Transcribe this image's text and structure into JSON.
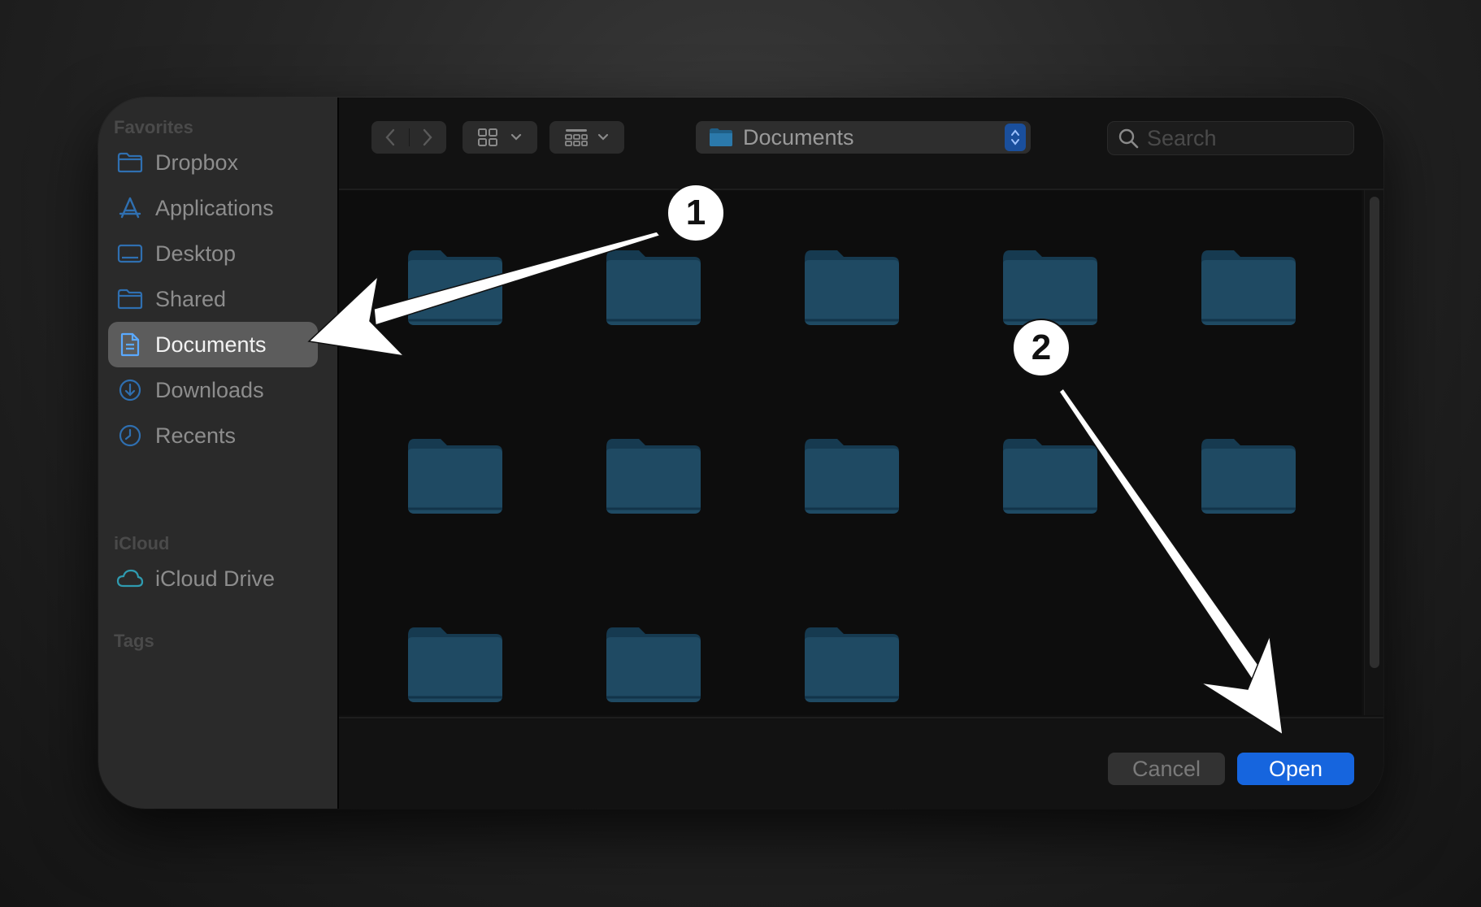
{
  "sidebar": {
    "favorites_label": "Favorites",
    "items": [
      {
        "label": "Dropbox",
        "icon": "folder-icon"
      },
      {
        "label": "Applications",
        "icon": "applications-icon"
      },
      {
        "label": "Desktop",
        "icon": "desktop-icon"
      },
      {
        "label": "Shared",
        "icon": "folder-icon"
      },
      {
        "label": "Documents",
        "icon": "document-icon",
        "selected": true
      },
      {
        "label": "Downloads",
        "icon": "download-icon"
      },
      {
        "label": "Recents",
        "icon": "clock-icon"
      }
    ],
    "icloud_label": "iCloud",
    "icloud_items": [
      {
        "label": "iCloud Drive",
        "icon": "cloud-icon"
      }
    ],
    "tags_label": "Tags"
  },
  "toolbar": {
    "path_label": "Documents",
    "search_placeholder": "Search"
  },
  "folder_count": 13,
  "buttons": {
    "cancel": "Cancel",
    "open": "Open"
  },
  "annotations": {
    "step1": "1",
    "step2": "2"
  },
  "colors": {
    "accent": "#1665de",
    "folder": "#1f4a63",
    "sidebar_icon": "#2f6fb0",
    "selection": "#5c5c5c"
  }
}
